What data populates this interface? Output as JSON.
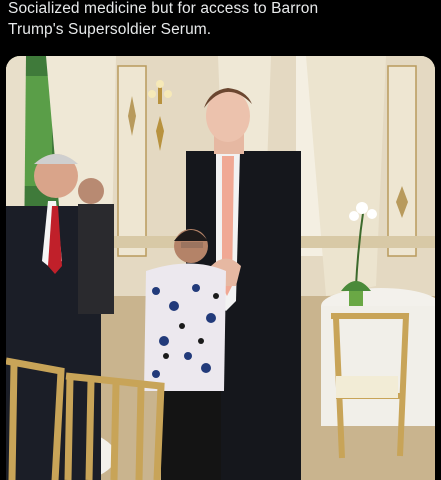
{
  "post": {
    "caption_line1": "Socialized medicine but for access to Barron",
    "caption_line2": "Trump's Supersoldier Serum."
  },
  "photo": {
    "alt": "",
    "wall_color": "#e4d9c2",
    "floor_color": "#c9b48e",
    "suit_color": "#15171c",
    "tie_color": "#f0a894",
    "chair_gold": "#c8a458"
  }
}
